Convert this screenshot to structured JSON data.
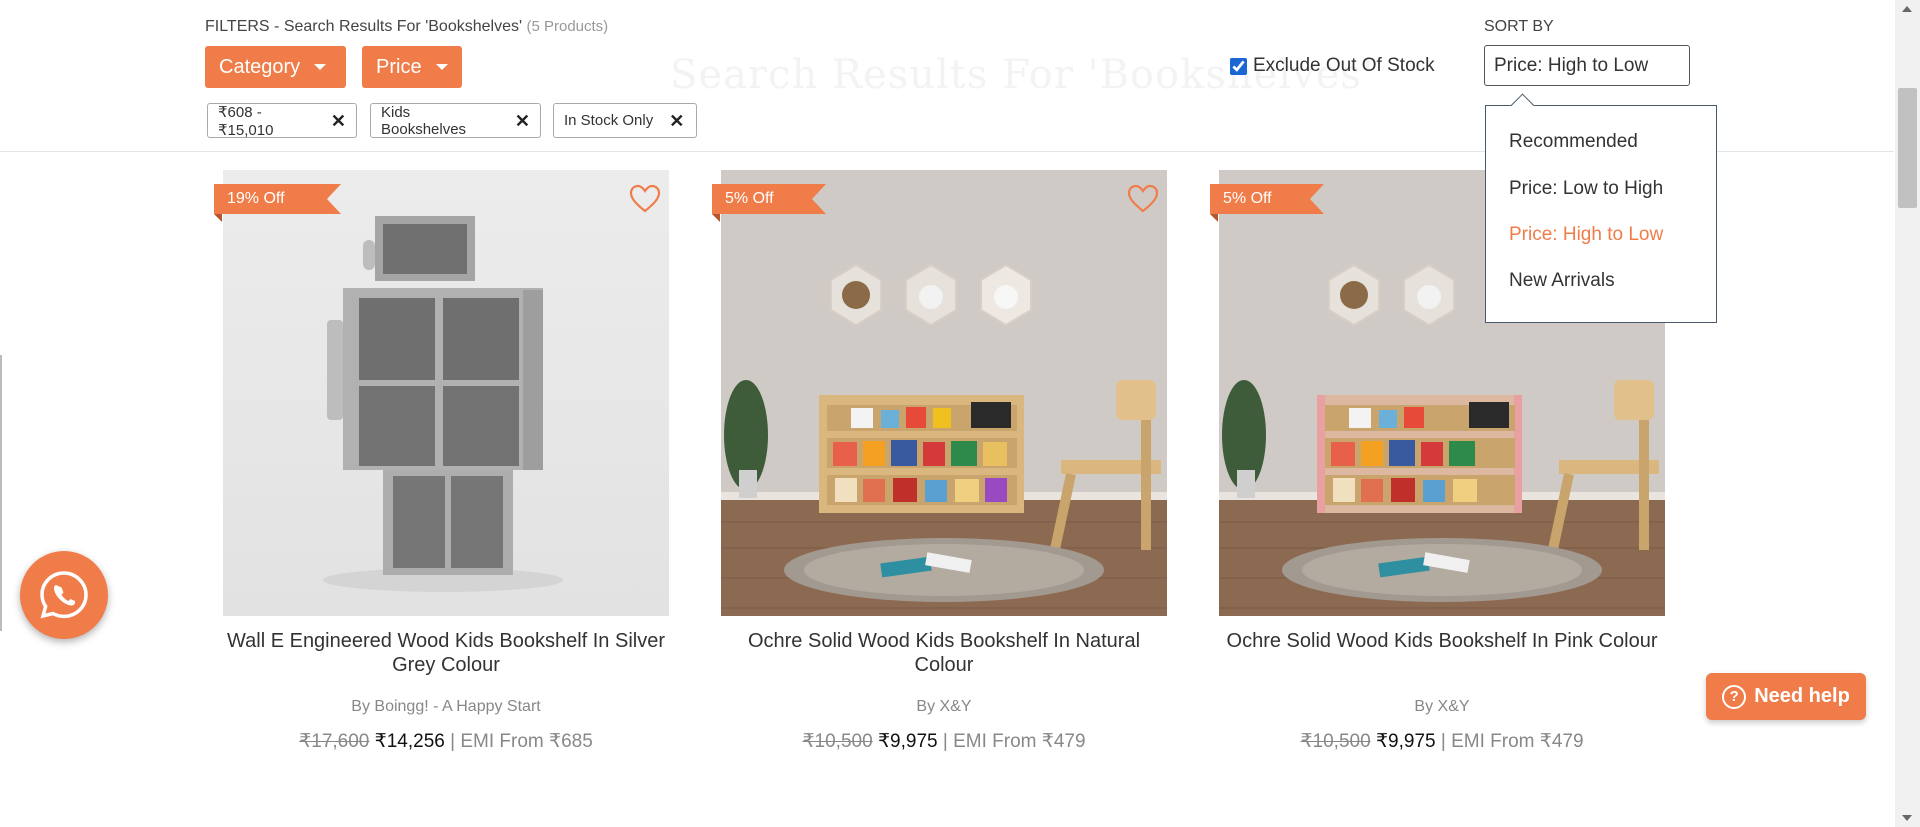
{
  "search": {
    "heading_prefix": "FILTERS - Search Results For 'Bookshelves'",
    "count": "(5 Products)",
    "ghost_title": "Search Results For 'Bookshelves'"
  },
  "filters": {
    "category_label": "Category",
    "price_label": "Price",
    "exclude_out_of_stock_label": "Exclude Out Of Stock",
    "exclude_out_of_stock_checked": true
  },
  "applied_filters": [
    {
      "label": "₹608 - ₹15,010"
    },
    {
      "label": "Kids Bookshelves"
    },
    {
      "label": "In Stock Only"
    }
  ],
  "sort": {
    "label": "SORT BY",
    "selected": "Price: High to Low",
    "options": [
      "Recommended",
      "Price: Low to High",
      "Price: High to Low",
      "New Arrivals"
    ]
  },
  "products": [
    {
      "discount": "19% Off",
      "title": "Wall E Engineered Wood Kids Bookshelf In Silver Grey Colour",
      "brand": "By Boingg! - A Happy Start",
      "mrp": "₹17,600",
      "price": "₹14,256",
      "emi": "| EMI From ₹685"
    },
    {
      "discount": "5% Off",
      "title": "Ochre Solid Wood Kids Bookshelf In Natural Colour",
      "brand": "By X&Y",
      "mrp": "₹10,500",
      "price": "₹9,975",
      "emi": "| EMI From ₹479"
    },
    {
      "discount": "5% Off",
      "title": "Ochre Solid Wood Kids Bookshelf In Pink Colour",
      "brand": "By X&Y",
      "mrp": "₹10,500",
      "price": "₹9,975",
      "emi": "| EMI From ₹479"
    }
  ],
  "help": {
    "label": "Need help"
  },
  "colors": {
    "accent": "#f07c49",
    "link_blue": "#1a66d2"
  },
  "icons": [
    "caret-down-icon",
    "close-icon",
    "heart-icon",
    "whatsapp-icon",
    "question-icon"
  ]
}
